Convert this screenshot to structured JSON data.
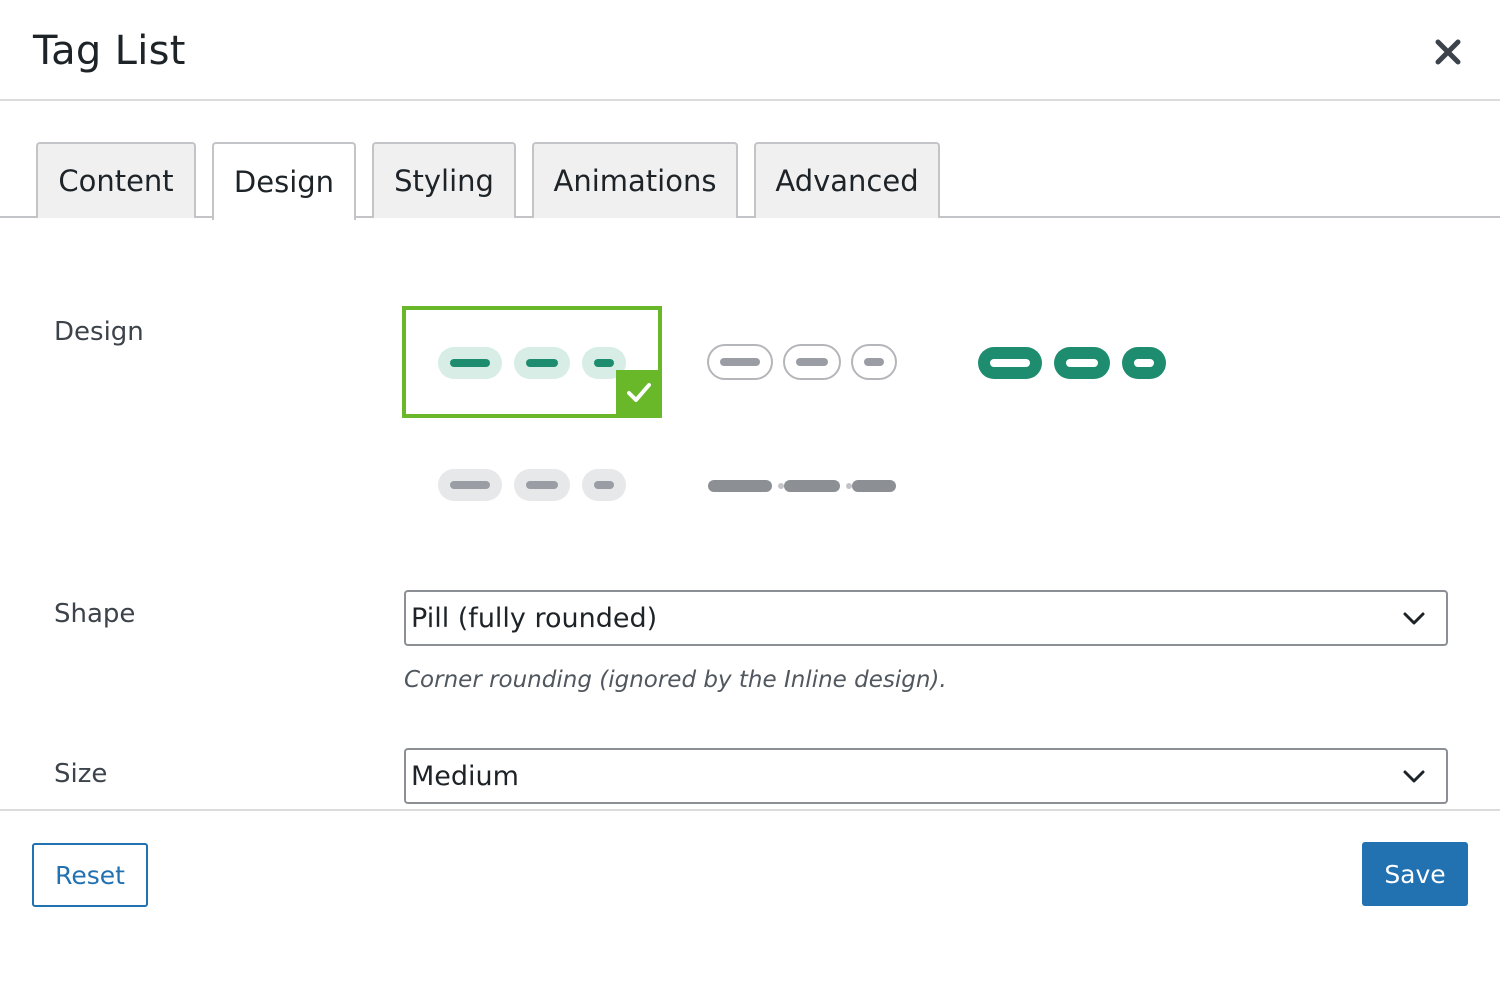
{
  "dialog": {
    "title": "Tag List",
    "close_icon": "close-icon"
  },
  "tabs": [
    {
      "label": "Content",
      "active": false
    },
    {
      "label": "Design",
      "active": true
    },
    {
      "label": "Styling",
      "active": false
    },
    {
      "label": "Animations",
      "active": false
    },
    {
      "label": "Advanced",
      "active": false
    }
  ],
  "design": {
    "label": "Design",
    "options": [
      {
        "id": "soft",
        "selected": true
      },
      {
        "id": "outline",
        "selected": false
      },
      {
        "id": "solid",
        "selected": false
      },
      {
        "id": "soft-gray",
        "selected": false
      },
      {
        "id": "inline",
        "selected": false
      }
    ],
    "colors": {
      "accent": "#1e8c6e",
      "accent_soft": "#d7ede6",
      "gray": "#9a9ea4",
      "gray_soft": "#e7e8ea",
      "selected_border": "#68b829"
    }
  },
  "shape": {
    "label": "Shape",
    "value": "Pill (fully rounded)",
    "help": "Corner rounding (ignored by the Inline design)."
  },
  "size": {
    "label": "Size",
    "value": "Medium"
  },
  "footer": {
    "reset_label": "Reset",
    "save_label": "Save",
    "primary_color": "#2271b1"
  }
}
